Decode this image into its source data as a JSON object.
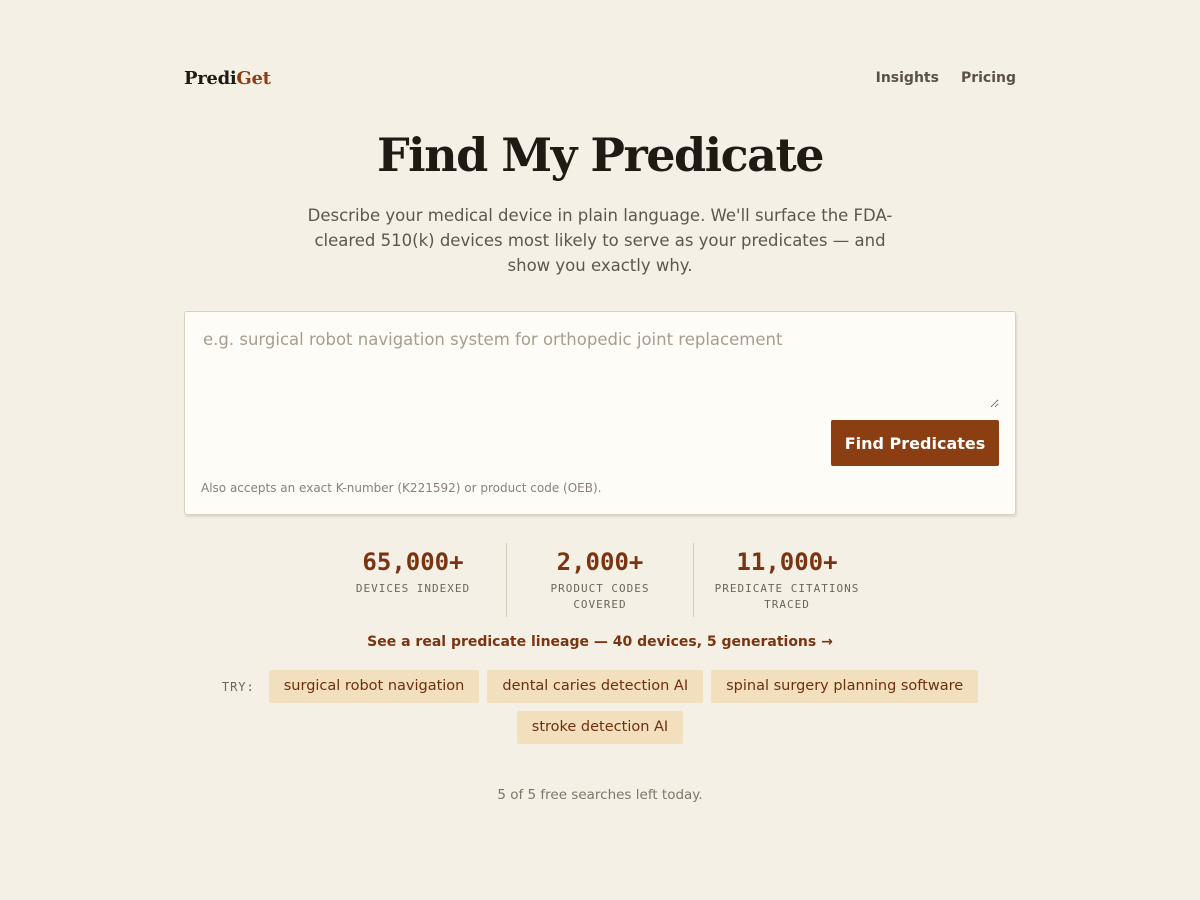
{
  "nav": {
    "logo_part1": "Predi",
    "logo_part2": "Get",
    "links": [
      "Insights",
      "Pricing"
    ]
  },
  "hero": {
    "title": "Find My Predicate",
    "subtitle": "Describe your medical device in plain language. We'll surface the FDA-cleared 510(k) devices most likely to serve as your predicates — and show you exactly why."
  },
  "search": {
    "value": "",
    "placeholder": "e.g. surgical robot navigation system for orthopedic joint replacement",
    "button_label": "Find Predicates",
    "hint": "Also accepts an exact K-number (K221592) or product code (OEB)."
  },
  "stats": [
    {
      "value": "65,000+",
      "label": "Devices Indexed"
    },
    {
      "value": "2,000+",
      "label": "Product Codes Covered"
    },
    {
      "value": "11,000+",
      "label": "Predicate Citations Traced"
    }
  ],
  "lineage_link": "See a real predicate lineage — 40 devices, 5 generations →",
  "try": {
    "label": "TRY:",
    "chips": [
      "surgical robot navigation",
      "dental caries detection AI",
      "spinal surgery planning software",
      "stroke detection AI"
    ]
  },
  "quota": "5 of 5 free searches left today.",
  "colors": {
    "background": "#f5f0e6",
    "accent": "#8b3e12",
    "chip_bg": "#f1dfbe"
  }
}
